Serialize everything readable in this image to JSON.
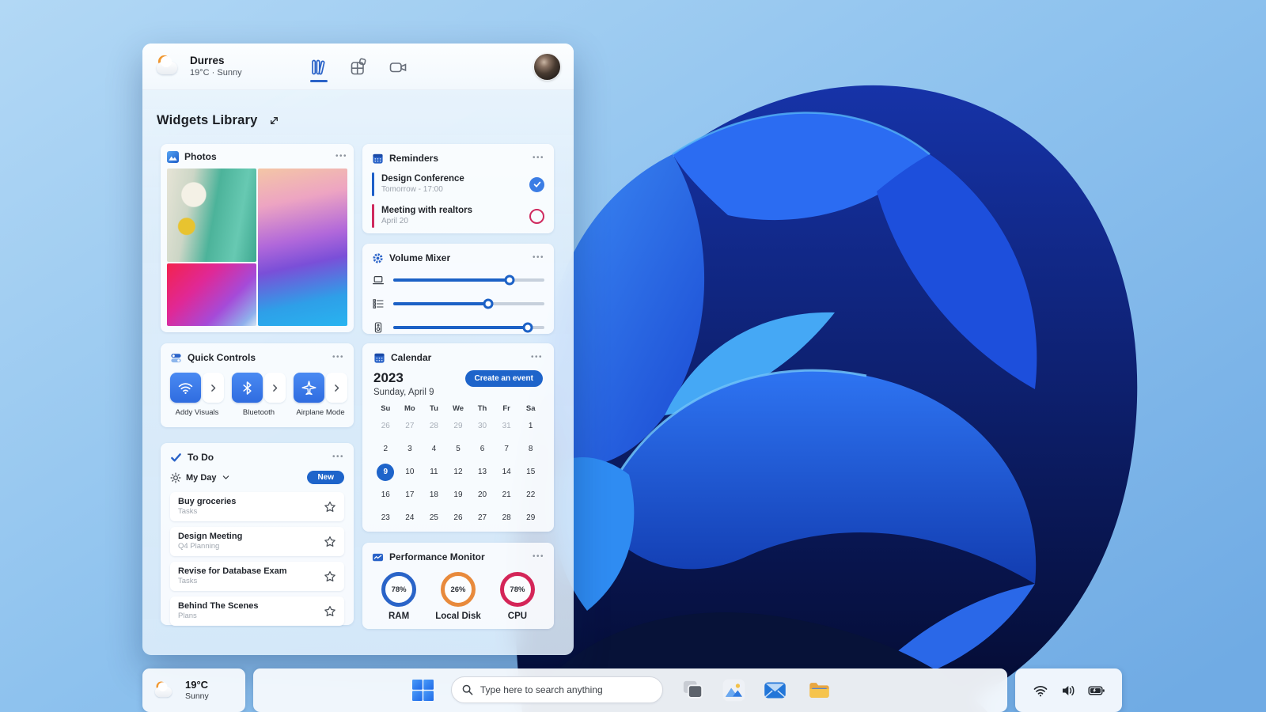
{
  "ui": {
    "menu_glyph": "•••"
  },
  "panel": {
    "weather": {
      "city": "Durres",
      "temp": "19°C",
      "separator": "·",
      "condition": "Sunny"
    },
    "tabs": [
      {
        "id": "widgets-library",
        "active": true
      },
      {
        "id": "widgets-board",
        "active": false
      },
      {
        "id": "camera",
        "active": false
      }
    ],
    "title": "Widgets Library"
  },
  "widgets": {
    "photos": {
      "title": "Photos"
    },
    "reminders": {
      "title": "Reminders",
      "items": [
        {
          "title": "Design Conference",
          "time": "Tomorrow - 17:00",
          "accent": "#1e5fc8",
          "done": true
        },
        {
          "title": "Meeting with realtors",
          "time": "April 20",
          "accent": "#cf2a5e",
          "done": false
        }
      ]
    },
    "volume_mixer": {
      "title": "Volume Mixer",
      "accent": "#1c61c6",
      "sliders": [
        {
          "device": "laptop",
          "value": 77
        },
        {
          "device": "queue",
          "value": 63
        },
        {
          "device": "speaker",
          "value": 89
        }
      ]
    },
    "quick_controls": {
      "title": "Quick Controls",
      "controls": [
        {
          "icon": "wifi",
          "label": "Addy Visuals"
        },
        {
          "icon": "bluetooth",
          "label": "Bluetooth"
        },
        {
          "icon": "airplane",
          "label": "Airplane Mode"
        }
      ]
    },
    "calendar": {
      "title": "Calendar",
      "year": "2023",
      "create_button": "Create an event",
      "date_label": "Sunday, April 9",
      "day_headers": [
        "Su",
        "Mo",
        "Tu",
        "We",
        "Th",
        "Fr",
        "Sa"
      ],
      "days": [
        "26",
        "27",
        "28",
        "29",
        "30",
        "31",
        "1",
        "2",
        "3",
        "4",
        "5",
        "6",
        "7",
        "8",
        "9",
        "10",
        "11",
        "12",
        "13",
        "14",
        "15",
        "16",
        "17",
        "18",
        "19",
        "20",
        "21",
        "22",
        "23",
        "24",
        "25",
        "26",
        "27",
        "28",
        "29"
      ],
      "muted_indexes": [
        0,
        1,
        2,
        3,
        4,
        5
      ],
      "selected_index": 14
    },
    "todo": {
      "title": "To Do",
      "list_label": "My Day",
      "new_button": "New",
      "tasks": [
        {
          "title": "Buy groceries",
          "list": "Tasks"
        },
        {
          "title": "Design Meeting",
          "list": "Q4 Planning"
        },
        {
          "title": "Revise for Database Exam",
          "list": "Tasks"
        },
        {
          "title": "Behind The Scenes",
          "list": "Plans"
        }
      ]
    },
    "performance": {
      "title": "Performance Monitor",
      "meters": [
        {
          "label": "RAM",
          "value": "78%",
          "color": "#2a64c8"
        },
        {
          "label": "Local Disk",
          "value": "26%",
          "color": "#e88a3c"
        },
        {
          "label": "CPU",
          "value": "78%",
          "color": "#d42558"
        }
      ]
    }
  },
  "taskbar": {
    "weather": {
      "temp": "19°C",
      "condition": "Sunny"
    },
    "search": {
      "placeholder": "Type here to search anything"
    },
    "apps": [
      "task-view",
      "photos",
      "mail",
      "file-explorer"
    ],
    "tray": [
      "wifi",
      "volume",
      "battery"
    ]
  },
  "colors": {
    "accent": "#1e64ca"
  }
}
